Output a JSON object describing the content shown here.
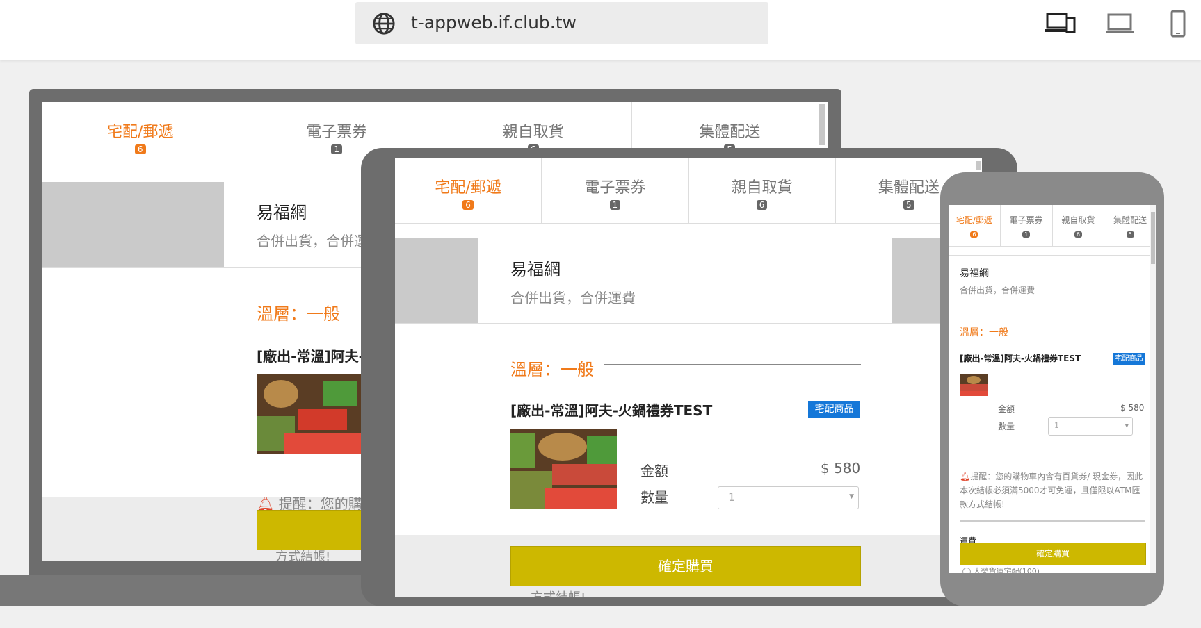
{
  "browser": {
    "url": "t-appweb.if.club.tw",
    "icons": [
      "globe-icon",
      "responsive-devices-icon",
      "laptop-icon",
      "mobile-phone-icon"
    ]
  },
  "tabs": [
    {
      "label": "宅配/郵遞",
      "count": "6",
      "active": true
    },
    {
      "label": "電子票券",
      "count": "1",
      "active": false
    },
    {
      "label": "親自取貨",
      "count": "6",
      "active": false
    },
    {
      "label": "集體配送",
      "count": "5",
      "active": false
    }
  ],
  "store": {
    "name": "易福網",
    "subtitle": "合併出貨，合併運費"
  },
  "temperature_label": "溫層：一般",
  "product": {
    "name": "[廠出-常溫]阿夫-火鍋禮券TEST",
    "tag": "宅配商品",
    "amount_label": "金額",
    "amount": "$ 580",
    "qty_label": "數量",
    "qty_value": "1"
  },
  "reminder": {
    "short": "提醒：您的購",
    "full": "提醒：您的購物車內含有百貨券/ 現金券，因此本次結帳必須滿5000才可免運，且僅限以ATM匯款方式結帳!",
    "tail_laptop": "方式結帳!",
    "tail_tablet": "方式結帳!"
  },
  "shipping": {
    "label": "運費",
    "option": "大榮貨運宅配(100)"
  },
  "buy_button": "確定購買",
  "colors": {
    "accent": "#f07a1a",
    "buy": "#cdb800",
    "tag": "#1577d8",
    "frame": "#6d6d6d"
  }
}
